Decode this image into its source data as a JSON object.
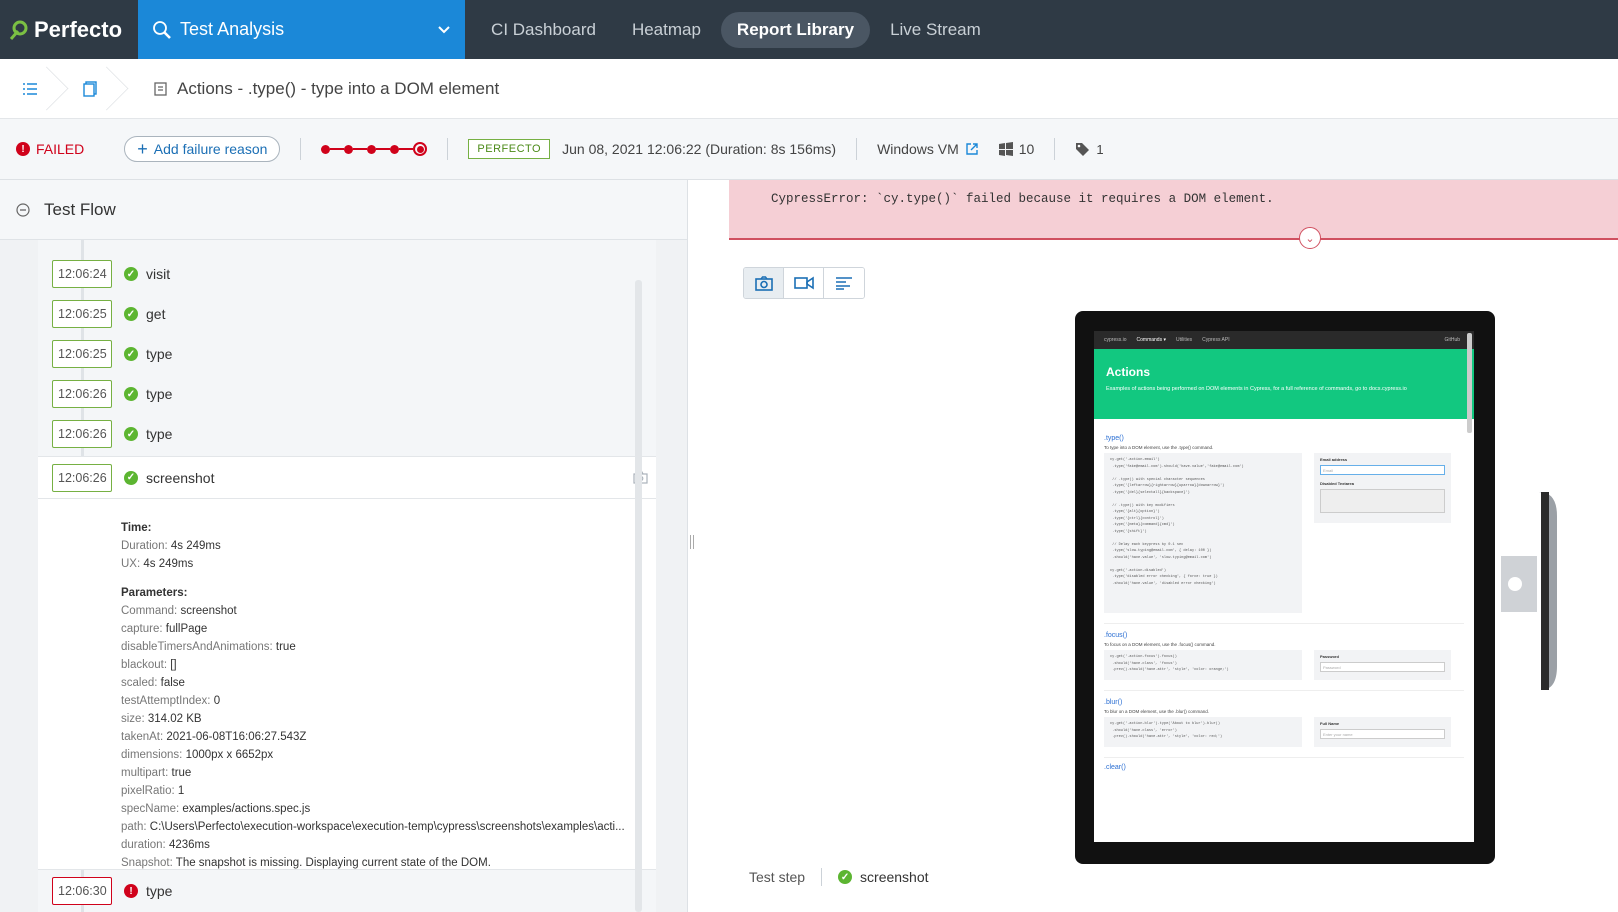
{
  "brand": {
    "name": "Perfecto"
  },
  "top_nav": {
    "app_switcher": "Test Analysis",
    "tabs": [
      "CI Dashboard",
      "Heatmap",
      "Report Library",
      "Live Stream"
    ],
    "active_tab": "Report Library"
  },
  "breadcrumb": {
    "title": "Actions - .type() - type into a DOM element"
  },
  "summary": {
    "status": "FAILED",
    "add_failure_reason": "Add failure reason",
    "source_badge": "PERFECTO",
    "date": "Jun 08, 2021 12:06:22 (Duration: 8s 156ms)",
    "platform": "Windows VM",
    "os_version": "10",
    "tag_count": "1"
  },
  "test_flow": {
    "header": "Test Flow",
    "steps": [
      {
        "time": "12:06:24",
        "name": "visit",
        "status": "passed"
      },
      {
        "time": "12:06:25",
        "name": "get",
        "status": "passed"
      },
      {
        "time": "12:06:25",
        "name": "type",
        "status": "passed"
      },
      {
        "time": "12:06:26",
        "name": "type",
        "status": "passed"
      },
      {
        "time": "12:06:26",
        "name": "type",
        "status": "passed"
      },
      {
        "time": "12:06:26",
        "name": "screenshot",
        "status": "passed"
      },
      {
        "time": "12:06:30",
        "name": "type",
        "status": "failed"
      }
    ],
    "detail": {
      "time_heading": "Time:",
      "duration_label": "Duration:",
      "duration": "4s 249ms",
      "ux_label": "UX:",
      "ux": "4s 249ms",
      "params_heading": "Parameters:",
      "params": [
        {
          "k": "Command:",
          "v": "screenshot"
        },
        {
          "k": "capture:",
          "v": "fullPage"
        },
        {
          "k": "disableTimersAndAnimations:",
          "v": "true"
        },
        {
          "k": "blackout:",
          "v": "[]"
        },
        {
          "k": "scaled:",
          "v": "false"
        },
        {
          "k": "testAttemptIndex:",
          "v": "0"
        },
        {
          "k": "size:",
          "v": "314.02 KB"
        },
        {
          "k": "takenAt:",
          "v": "2021-06-08T16:06:27.543Z"
        },
        {
          "k": "dimensions:",
          "v": "1000px x 6652px"
        },
        {
          "k": "multipart:",
          "v": "true"
        },
        {
          "k": "pixelRatio:",
          "v": "1"
        },
        {
          "k": "specName:",
          "v": "examples/actions.spec.js"
        },
        {
          "k": "path:",
          "v": "C:\\Users\\Perfecto\\execution-workspace\\execution-temp\\cypress\\screenshots\\examples\\acti..."
        },
        {
          "k": "duration:",
          "v": "4236ms"
        },
        {
          "k": "Snapshot:",
          "v": "The snapshot is missing. Displaying current state of the DOM."
        }
      ]
    }
  },
  "error": {
    "message": "CypressError: `cy.type()` failed because it requires a DOM element."
  },
  "footer": {
    "label": "Test step",
    "step": "screenshot"
  },
  "screenshot_page": {
    "nav": [
      "cypress.io",
      "Commands ▾",
      "Utilities",
      "Cypress API",
      "GitHub"
    ],
    "title": "Actions",
    "intro": "Examples of actions being performed on DOM elements in Cypress, for a full reference of commands, go to docs.cypress.io",
    "s1": ".type()",
    "s1_desc": "To type into a DOM element, use the .type() command.",
    "email_label": "Email address",
    "email_ph": "Email",
    "textarea_label": "Disabled Textarea",
    "s2": ".focus()",
    "s2_desc": "To focus on a DOM element, use the .focus() command.",
    "password_label": "Password",
    "password_ph": "Password",
    "s3": ".blur()",
    "s3_desc": "To blur on a DOM element, use the .blur() command.",
    "fullname_label": "Full Name",
    "fullname_ph": "Enter your name",
    "s4": ".clear()"
  },
  "colors": {
    "accent": "#1b88d8",
    "fail": "#d0021b",
    "pass": "#5cb531"
  }
}
